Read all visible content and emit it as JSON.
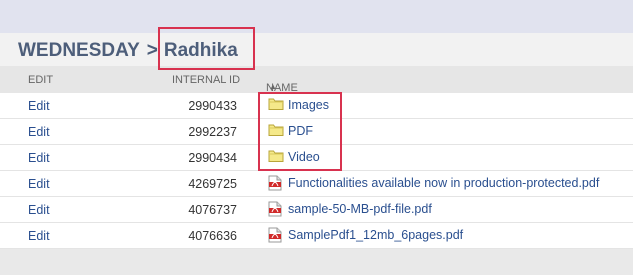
{
  "breadcrumb": {
    "parent": "WEDNESDAY",
    "separator": ">",
    "current": "Radhika"
  },
  "columns": {
    "edit": "EDIT",
    "internal_id": "INTERNAL ID",
    "name": "NAME",
    "name_sort_arrow": "▲"
  },
  "rows": [
    {
      "edit": "Edit",
      "id": "2990433",
      "name": "Images",
      "icon": "folder-icon"
    },
    {
      "edit": "Edit",
      "id": "2992237",
      "name": "PDF",
      "icon": "folder-icon"
    },
    {
      "edit": "Edit",
      "id": "2990434",
      "name": "Video",
      "icon": "folder-icon"
    },
    {
      "edit": "Edit",
      "id": "4269725",
      "name": "Functionalities available now in production-protected.pdf",
      "icon": "pdf-file-icon"
    },
    {
      "edit": "Edit",
      "id": "4076737",
      "name": "sample-50-MB-pdf-file.pdf",
      "icon": "pdf-file-icon"
    },
    {
      "edit": "Edit",
      "id": "4076636",
      "name": "SamplePdf1_12mb_6pages.pdf",
      "icon": "pdf-file-icon"
    }
  ],
  "colors": {
    "link": "#2a4f8f",
    "highlight": "#d8324f",
    "title": "#4d5e7a"
  }
}
